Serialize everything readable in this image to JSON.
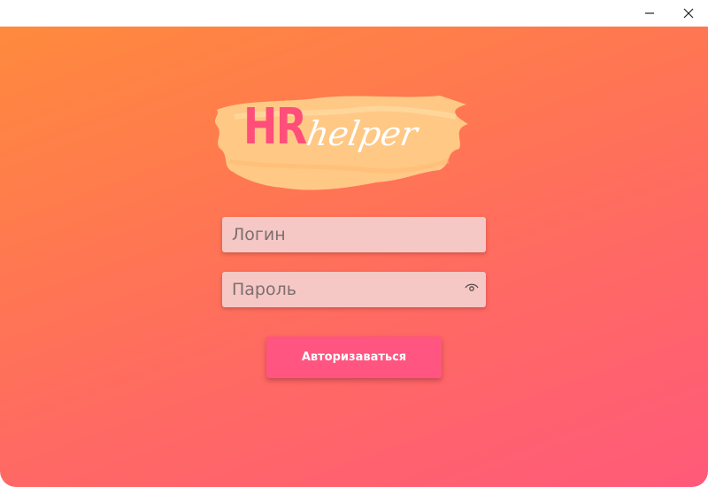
{
  "window": {
    "controls": {
      "minimize_icon": "minimize-icon",
      "close_icon": "close-icon"
    }
  },
  "logo": {
    "part1": "HR",
    "part2": "helper"
  },
  "form": {
    "login_placeholder": "Логин",
    "password_placeholder": "Пароль",
    "password_toggle_icon": "eye-icon",
    "submit_label": "Авторизаваться"
  },
  "colors": {
    "gradient_start": "#ff8a3d",
    "gradient_end": "#ff5a7a",
    "accent": "#ff5580",
    "field_bg": "#f5c8c6",
    "logo_splash": "#ffcf8a"
  }
}
